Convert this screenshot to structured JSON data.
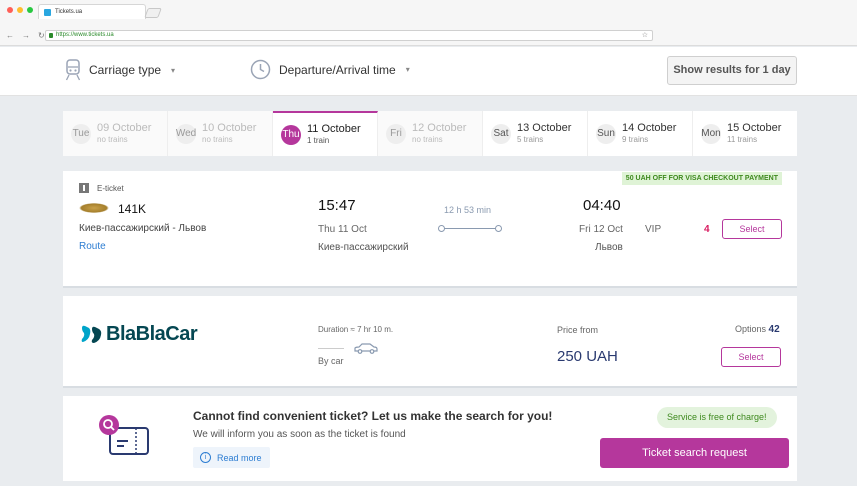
{
  "browser": {
    "tab_title": "Tickets.ua",
    "url": "https://www.tickets.ua",
    "colors": {
      "close": "#ff5f57",
      "minimize": "#ffbd2e",
      "maximize": "#28c840"
    }
  },
  "filters": {
    "carriage_type": "Carriage type",
    "departure_arrival": "Departure/Arrival time",
    "show_results": "Show results for 1 day"
  },
  "dates": [
    {
      "weekday": "Tue",
      "label": "09 October",
      "sub": "no trains",
      "state": "none"
    },
    {
      "weekday": "Wed",
      "label": "10 October",
      "sub": "no trains",
      "state": "none"
    },
    {
      "weekday": "Thu",
      "label": "11 October",
      "sub": "1 train",
      "state": "active"
    },
    {
      "weekday": "Fri",
      "label": "12 October",
      "sub": "no trains",
      "state": "none"
    },
    {
      "weekday": "Sat",
      "label": "13 October",
      "sub": "5 trains",
      "state": "available"
    },
    {
      "weekday": "Sun",
      "label": "14 October",
      "sub": "9 trains",
      "state": "available"
    },
    {
      "weekday": "Mon",
      "label": "15 October",
      "sub": "11 trains",
      "state": "available"
    }
  ],
  "train": {
    "promo": "50 UAH OFF FOR VISA CHECKOUT PAYMENT",
    "eticket": "E-ticket",
    "number": "141K",
    "route": "Киев-пассажирский - Львов",
    "route_link": "Route",
    "departure": {
      "time": "15:47",
      "date": "Thu 11 Oct",
      "station": "Киев-пассажирский"
    },
    "duration": "12 h 53 min",
    "arrival": {
      "time": "04:40",
      "date": "Fri 12 Oct",
      "station": "Львов"
    },
    "wagon": "VIP",
    "seats": "4",
    "select": "Select"
  },
  "blablacar": {
    "brand": "BlaBlaCar",
    "duration": "Duration ≈ 7 hr 10 m.",
    "by": "By car",
    "price_from": "Price from",
    "price": "250 UAH",
    "options_label": "Options",
    "options_count": "42",
    "select": "Select"
  },
  "search_request": {
    "title": "Cannot find convenient ticket? Let us make the search for you!",
    "subtitle": "We will inform you as soon as the ticket is found",
    "read_more": "Read more",
    "free": "Service is free of charge!",
    "button": "Ticket search request"
  }
}
